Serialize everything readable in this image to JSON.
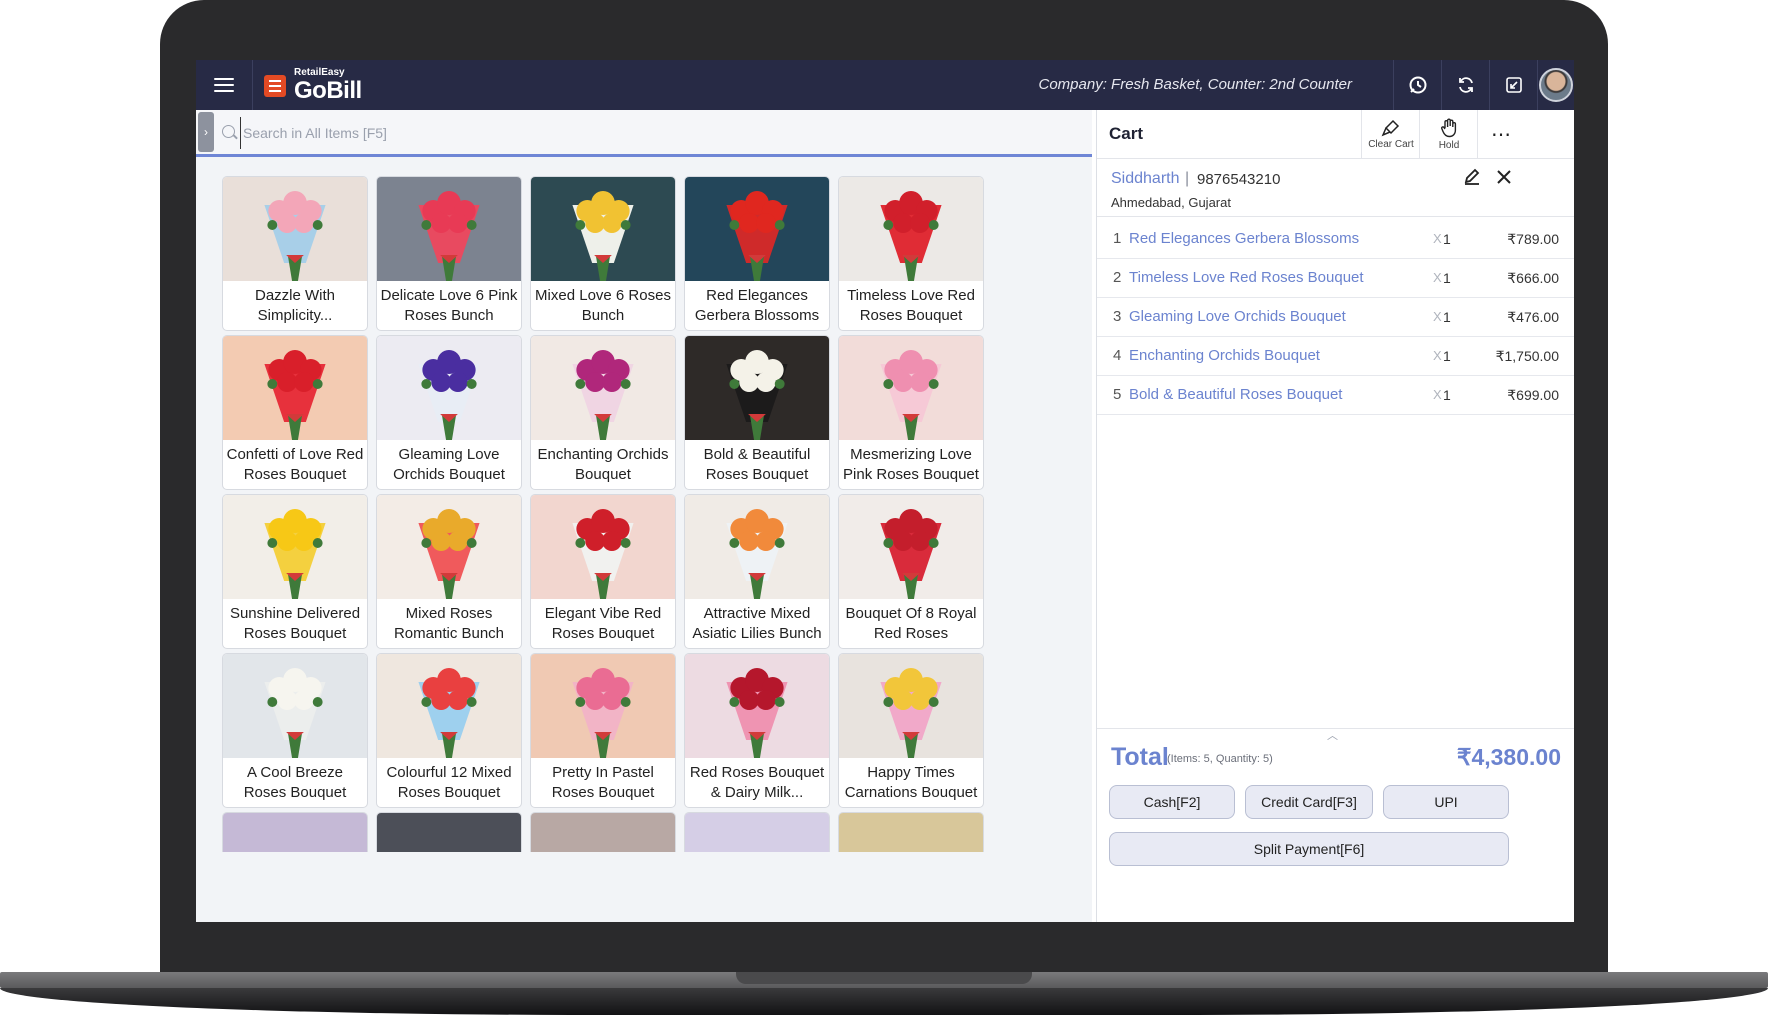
{
  "header": {
    "brand_small": "RetailEasy",
    "brand_big": "GoBill",
    "company_info": "Company: Fresh Basket,  Counter: 2nd Counter",
    "colors": {
      "bar": "#272a45",
      "accent": "#6b83cf",
      "logo": "#e34a24"
    },
    "icons": [
      "menu-icon",
      "support-icon",
      "sync-icon",
      "exit-fullscreen-icon",
      "avatar"
    ]
  },
  "search": {
    "placeholder": "Search in All Items [F5]",
    "toggle_glyph": "›"
  },
  "products": [
    {
      "name": "Dazzle With Simplicity...",
      "color": "#f3a6b8",
      "bg": "#e9dfd9",
      "wrap": "#a8cfe8"
    },
    {
      "name": "Delicate Love 6 Pink Roses Bunch",
      "color": "#e83a55",
      "bg": "#7c8390",
      "wrap": "#e84a60"
    },
    {
      "name": "Mixed Love 6 Roses Bunch",
      "color": "#f1c232",
      "bg": "#2d4a52",
      "wrap": "#eef0ea"
    },
    {
      "name": "Red Elegances Gerbera Blossoms",
      "color": "#e0271f",
      "bg": "#23465a",
      "wrap": "#cf2a2a"
    },
    {
      "name": "Timeless Love Red Roses Bouquet",
      "color": "#d11f2b",
      "bg": "#ece9e6",
      "wrap": "#e02c35"
    },
    {
      "name": "Confetti of Love Red Roses Bouquet",
      "color": "#d91f2a",
      "bg": "#f3cbb2",
      "wrap": "#e7313c"
    },
    {
      "name": "Gleaming Love Orchids Bouquet",
      "color": "#4a2ea0",
      "bg": "#ecebf2",
      "wrap": "#e8edf5"
    },
    {
      "name": "Enchanting Orchids Bouquet",
      "color": "#b0277b",
      "bg": "#f1e9e4",
      "wrap": "#f0d5e3"
    },
    {
      "name": "Bold & Beautiful Roses Bouquet",
      "color": "#f4f2e8",
      "bg": "#2e2a28",
      "wrap": "#1c1b1b"
    },
    {
      "name": "Mesmerizing Love Pink Roses Bouquet",
      "color": "#ef8fb0",
      "bg": "#f2dcd9",
      "wrap": "#f6c9d6"
    },
    {
      "name": "Sunshine Delivered Roses Bouquet",
      "color": "#f7c816",
      "bg": "#f2eee8",
      "wrap": "#f4d03f"
    },
    {
      "name": "Mixed Roses Romantic Bunch",
      "color": "#e9aa2b",
      "bg": "#f3ece6",
      "wrap": "#f05a5c"
    },
    {
      "name": "Elegant Vibe Red Roses Bouquet",
      "color": "#cf1f2a",
      "bg": "#f2d6cf",
      "wrap": "#f1f1ef"
    },
    {
      "name": "Attractive Mixed Asiatic Lilies Bunch",
      "color": "#f18a3b",
      "bg": "#f0ebe6",
      "wrap": "#eef2f5"
    },
    {
      "name": "Bouquet Of 8 Royal Red Roses",
      "color": "#c41e2c",
      "bg": "#f1ece9",
      "wrap": "#d92b3b"
    },
    {
      "name": "A Cool Breeze Roses Bouquet",
      "color": "#f6f5ef",
      "bg": "#e2e6ea",
      "wrap": "#eceeed"
    },
    {
      "name": "Colourful 12 Mixed Roses Bouquet",
      "color": "#e94040",
      "bg": "#efe7df",
      "wrap": "#9ed0ee"
    },
    {
      "name": "Pretty In Pastel Roses Bouquet",
      "color": "#ea6c93",
      "bg": "#f0c9b3",
      "wrap": "#f2b4c6"
    },
    {
      "name": "Red Roses Bouquet & Dairy Milk...",
      "color": "#b5172c",
      "bg": "#eddbe2",
      "wrap": "#ef94b2"
    },
    {
      "name": "Happy Times Carnations Bouquet",
      "color": "#f2c63a",
      "bg": "#e8e3de",
      "wrap": "#f1a9c9"
    }
  ],
  "partial_row_colors": [
    "#c5b9d6",
    "#4c4f58",
    "#b8a8a4",
    "#d5cee6",
    "#d8c79a"
  ],
  "cart": {
    "title": "Cart",
    "actions": {
      "clear": "Clear Cart",
      "hold": "Hold",
      "more": "⋯"
    },
    "customer": {
      "name": "Siddharth",
      "separator": "|",
      "phone": "9876543210",
      "address": "Ahmedabad, Gujarat"
    },
    "items": [
      {
        "idx": "1",
        "name": "Red Elegances Gerbera Blossoms",
        "x": "X",
        "qty": "1",
        "price": "₹789.00"
      },
      {
        "idx": "2",
        "name": "Timeless Love Red Roses Bouquet",
        "x": "X",
        "qty": "1",
        "price": "₹666.00"
      },
      {
        "idx": "3",
        "name": "Gleaming Love Orchids Bouquet",
        "x": "X",
        "qty": "1",
        "price": "₹476.00"
      },
      {
        "idx": "4",
        "name": "Enchanting Orchids Bouquet",
        "x": "X",
        "qty": "1",
        "price": "₹1,750.00"
      },
      {
        "idx": "5",
        "name": "Bold & Beautiful Roses Bouquet",
        "x": "X",
        "qty": "1",
        "price": "₹699.00"
      }
    ],
    "total_label": "Total",
    "total_meta": "(Items: 5, Quantity: 5)",
    "total_amount": "₹4,380.00",
    "payments": {
      "cash": "Cash[F2]",
      "card": "Credit Card[F3]",
      "upi": "UPI",
      "split": "Split Payment[F6]"
    }
  }
}
